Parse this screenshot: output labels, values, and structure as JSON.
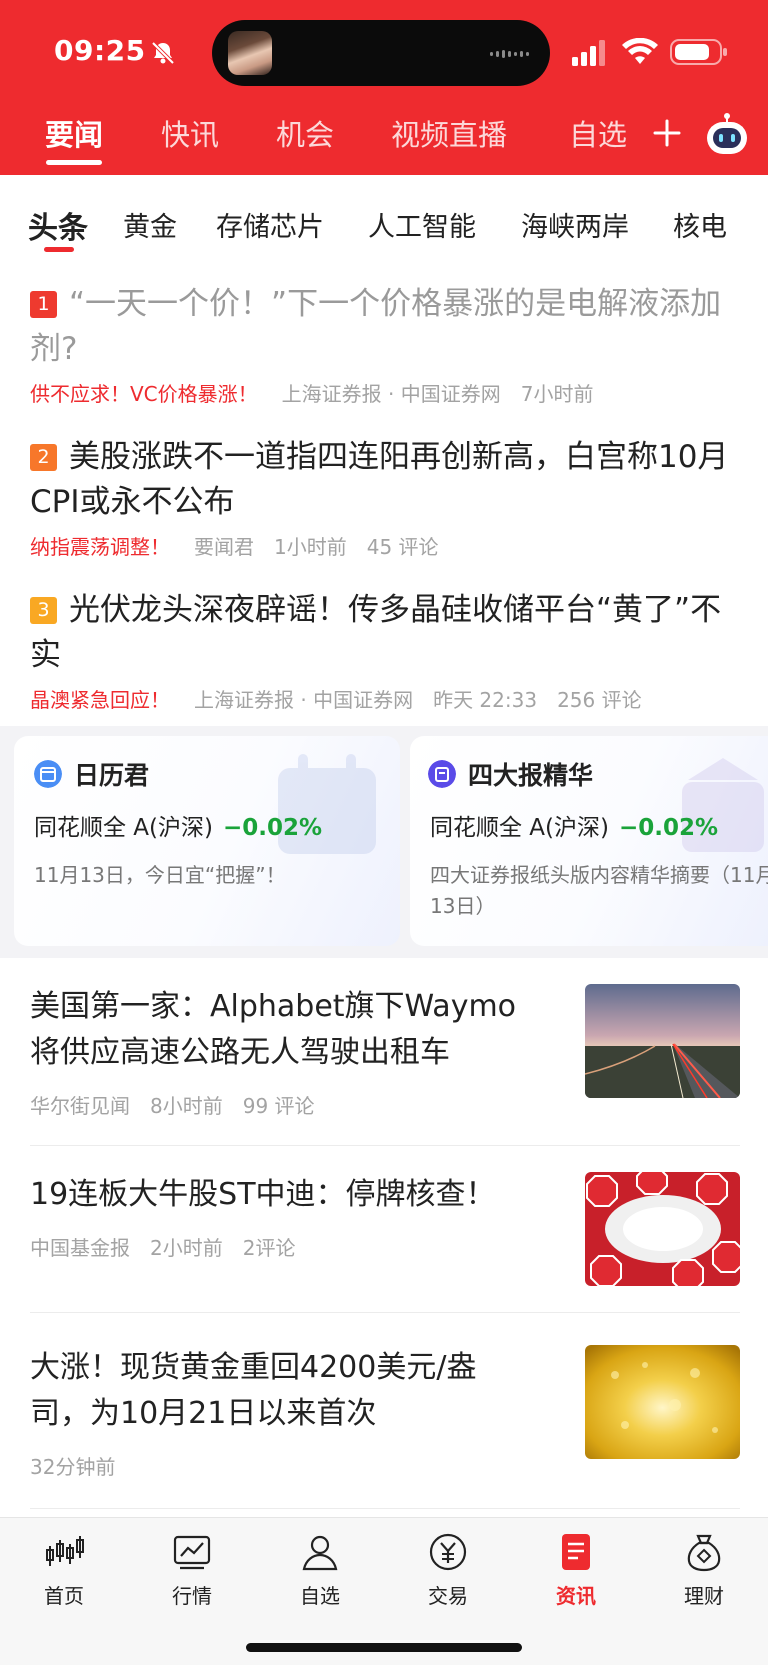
{
  "status_bar": {
    "time": "09:25"
  },
  "top_tabs": [
    {
      "label": "要闻",
      "active": true
    },
    {
      "label": "快讯"
    },
    {
      "label": "机会"
    },
    {
      "label": "视频直播"
    },
    {
      "label": "自选"
    }
  ],
  "sub_tabs": [
    {
      "label": "头条",
      "active": true
    },
    {
      "label": "黄金"
    },
    {
      "label": "存储芯片"
    },
    {
      "label": "人工智能"
    },
    {
      "label": "海峡两岸"
    },
    {
      "label": "核电"
    }
  ],
  "headlines": [
    {
      "rank": "1",
      "title": "“一天一个价！”下一个价格暴涨的是电解液添加剂?",
      "tag": "供不应求！VC价格暴涨！",
      "source": "上海证券报 · 中国证券网",
      "time": "7小时前",
      "comments": ""
    },
    {
      "rank": "2",
      "title": "美股涨跌不一道指四连阳再创新高，白宫称10月CPI或永不公布",
      "tag": "纳指震荡调整！",
      "source": "要闻君",
      "time": "1小时前",
      "comments": "45 评论"
    },
    {
      "rank": "3",
      "title": "光伏龙头深夜辟谣！传多晶硅收储平台“黄了”不实",
      "tag": "晶澳紧急回应！",
      "source": "上海证券报 · 中国证券网",
      "time": "昨天 22:33",
      "comments": "256 评论"
    }
  ],
  "cards": [
    {
      "title": "日历君",
      "index_name": "同花顺全 A(沪深)",
      "change": "−0.02%",
      "desc": "11月13日，今日宜“把握”！"
    },
    {
      "title": "四大报精华",
      "index_name": "同花顺全 A(沪深)",
      "change": "−0.02%",
      "desc": "四大证券报纸头版内容精华摘要（11月13日）"
    }
  ],
  "news": [
    {
      "title": "美国第一家：Alphabet旗下Waymo将供应高速公路无人驾驶出租车",
      "source": "华尔街见闻",
      "time": "8小时前",
      "comments": "99 评论"
    },
    {
      "title": "19连板大牛股ST中迪：停牌核查！",
      "source": "中国基金报",
      "time": "2小时前",
      "comments": "2评论"
    },
    {
      "title": "大涨！现货黄金重回4200美元/盎司，为10月21日以来首次",
      "source": "",
      "time": "32分钟前",
      "comments": ""
    }
  ],
  "bottom_nav": [
    {
      "label": "首页",
      "icon": "candlestick-icon"
    },
    {
      "label": "行情",
      "icon": "chart-icon"
    },
    {
      "label": "自选",
      "icon": "user-icon"
    },
    {
      "label": "交易",
      "icon": "yen-coin-icon"
    },
    {
      "label": "资讯",
      "icon": "news-icon",
      "active": true
    },
    {
      "label": "理财",
      "icon": "money-bag-icon"
    }
  ],
  "colors": {
    "brand_red": "#ee2b2f",
    "down_green": "#1aa33a",
    "muted": "#a3a3a3"
  }
}
